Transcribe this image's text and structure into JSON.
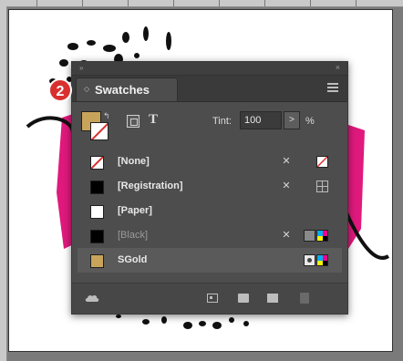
{
  "panel": {
    "tab_label": "Swatches",
    "callout_number": "2",
    "tint_label": "Tint:",
    "tint_value": "100",
    "tint_stepper": ">",
    "tint_unit": "%",
    "text_toggle": "T"
  },
  "swatches": [
    {
      "name": "[None]",
      "color": "#ffffff",
      "kind": "none",
      "dim": false
    },
    {
      "name": "[Registration]",
      "color": "#000000",
      "kind": "registration",
      "dim": false
    },
    {
      "name": "[Paper]",
      "color": "#ffffff",
      "kind": "paper",
      "dim": false
    },
    {
      "name": "[Black]",
      "color": "#000000",
      "kind": "black",
      "dim": true
    },
    {
      "name": "SGold",
      "color": "#c8a45a",
      "kind": "gold",
      "dim": false
    }
  ],
  "colors": {
    "accent_magenta": "#e0197d",
    "callout_red": "#d8302f",
    "gold": "#c8a45a"
  }
}
